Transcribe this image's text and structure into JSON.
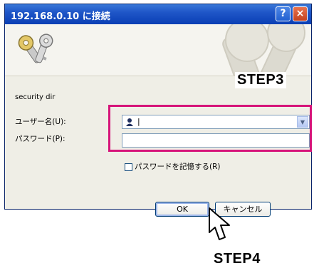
{
  "window": {
    "title": "192.168.0.10 に接続",
    "help_label": "?",
    "close_label": "×"
  },
  "annotations": {
    "step3": "STEP3",
    "step4": "STEP4"
  },
  "realm": "security dir",
  "form": {
    "username_label": "ユーザー名(U):",
    "username_value": "|",
    "password_label": "パスワード(P):",
    "password_value": "",
    "remember_label": "パスワードを記憶する(R)",
    "remember_checked": false
  },
  "buttons": {
    "ok": "OK",
    "cancel": "キャンセル"
  },
  "colors": {
    "titlebar": "#0a3fb4",
    "highlight": "#d6147a",
    "dialog_bg": "#efeee6"
  },
  "icons": {
    "keys": "keys-icon",
    "user": "user-icon",
    "dropdown": "chevron-down-icon",
    "cursor": "mouse-pointer-icon"
  }
}
